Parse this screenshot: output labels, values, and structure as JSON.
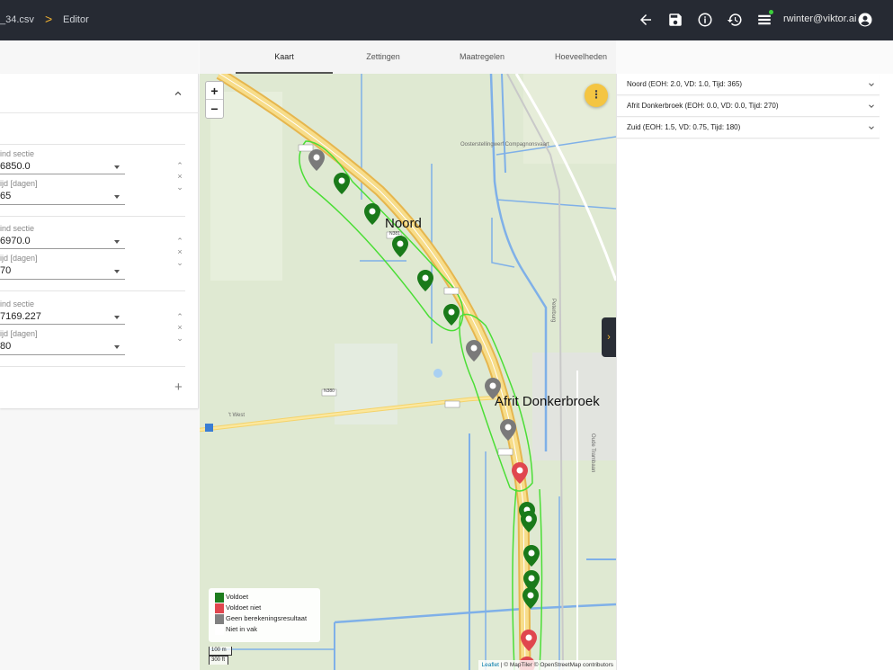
{
  "header": {
    "file_crumb": "_34.csv",
    "separator": ">",
    "editor_crumb": "Editor",
    "user_email": "rwinter@viktor.ai",
    "icons": [
      "back-arrow-icon",
      "save-icon",
      "info-icon",
      "history-icon",
      "list-icon",
      "account-icon"
    ],
    "status_dot_color": "#3bd13b"
  },
  "tabs": [
    {
      "label": "Kaart",
      "active": true
    },
    {
      "label": "Zettingen",
      "active": false
    },
    {
      "label": "Maatregelen",
      "active": false
    },
    {
      "label": "Hoeveelheden",
      "active": false
    }
  ],
  "left_panel": {
    "sections": [
      {
        "label_a": "ind sectie",
        "value_a": "6850.0",
        "label_b": "ijd [dagen]",
        "value_b": "65"
      },
      {
        "label_a": "ind sectie",
        "value_a": "6970.0",
        "label_b": "ijd [dagen]",
        "value_b": "70"
      },
      {
        "label_a": "ind sectie",
        "value_a": "7169.227",
        "label_b": "ijd [dagen]",
        "value_b": "80"
      }
    ],
    "remove_symbol": "×",
    "add_symbol": "+"
  },
  "map": {
    "zoom_in": "+",
    "zoom_out": "−",
    "menu_symbol": "⋮",
    "toggle_symbol": "›",
    "labels": {
      "noord": "Noord",
      "afrit": "Afrit Donkerbroek"
    },
    "place_labels": {
      "peterburg": "Peterburg",
      "oude_trambaan": "Oude Trambaan",
      "west": "'t West",
      "compagnie": "Oosterstellingwerf Compagnonsvaart",
      "n380": "N380",
      "n381": "N381"
    },
    "legend": [
      {
        "label": "Voldoet",
        "color": "#1e7d1e"
      },
      {
        "label": "Voldoet niet",
        "color": "#e0464e"
      },
      {
        "label": "Geen berekeningsresultaat",
        "color": "#808080"
      },
      {
        "label": "Niet in vak",
        "color": "#ffffff"
      }
    ],
    "scale": {
      "metric": "100 m",
      "imperial": "300 ft"
    },
    "attribution": {
      "leaflet": "Leaflet",
      "rest": " | © MapTiler © OpenStreetMap contributors"
    }
  },
  "right_panel": {
    "items": [
      {
        "label": "Noord (EOH: 2.0, VD: 1.0, Tijd: 365)"
      },
      {
        "label": "Afrit Donkerbroek (EOH: 0.0, VD: 0.0, Tijd: 270)"
      },
      {
        "label": "Zuid (EOH: 1.5, VD: 0.75, Tijd: 180)"
      }
    ]
  }
}
